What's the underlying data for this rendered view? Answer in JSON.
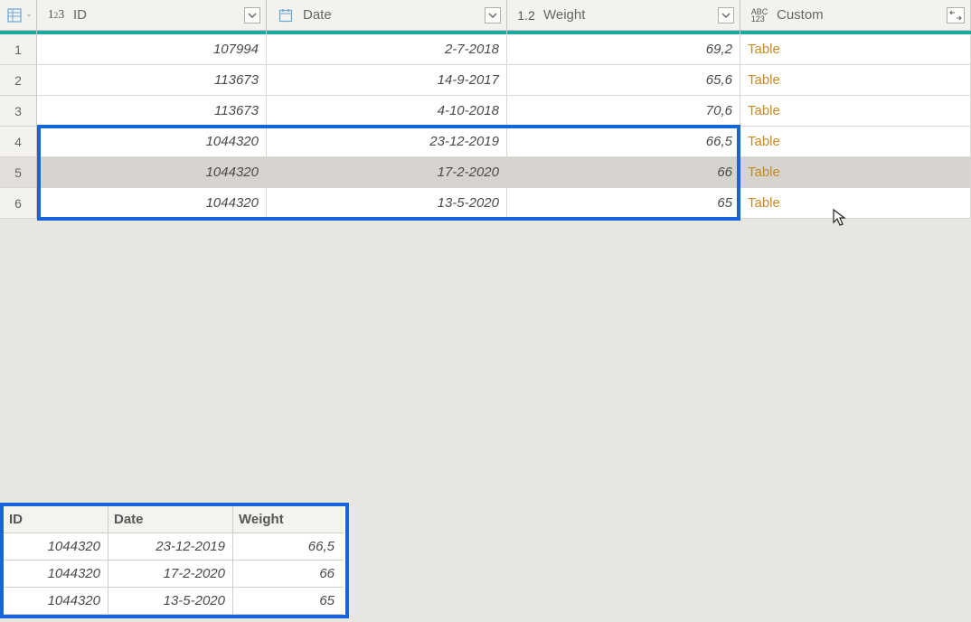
{
  "columns": {
    "id": {
      "label": "ID",
      "type": "int"
    },
    "date": {
      "label": "Date",
      "type": "date"
    },
    "weight": {
      "label": "Weight",
      "type": "decimal"
    },
    "custom": {
      "label": "Custom",
      "type": "any"
    }
  },
  "rows": [
    {
      "n": "1",
      "id": "107994",
      "date": "2-7-2018",
      "weight": "69,2",
      "custom": "Table",
      "selected": false
    },
    {
      "n": "2",
      "id": "113673",
      "date": "14-9-2017",
      "weight": "65,6",
      "custom": "Table",
      "selected": false
    },
    {
      "n": "3",
      "id": "113673",
      "date": "4-10-2018",
      "weight": "70,6",
      "custom": "Table",
      "selected": false
    },
    {
      "n": "4",
      "id": "1044320",
      "date": "23-12-2019",
      "weight": "66,5",
      "custom": "Table",
      "selected": false
    },
    {
      "n": "5",
      "id": "1044320",
      "date": "17-2-2020",
      "weight": "66",
      "custom": "Table",
      "selected": true
    },
    {
      "n": "6",
      "id": "1044320",
      "date": "13-5-2020",
      "weight": "65",
      "custom": "Table",
      "selected": false
    }
  ],
  "preview": {
    "headers": {
      "id": "ID",
      "date": "Date",
      "weight": "Weight"
    },
    "rows": [
      {
        "id": "1044320",
        "date": "23-12-2019",
        "weight": "66,5"
      },
      {
        "id": "1044320",
        "date": "17-2-2020",
        "weight": "66"
      },
      {
        "id": "1044320",
        "date": "13-5-2020",
        "weight": "65"
      }
    ]
  }
}
